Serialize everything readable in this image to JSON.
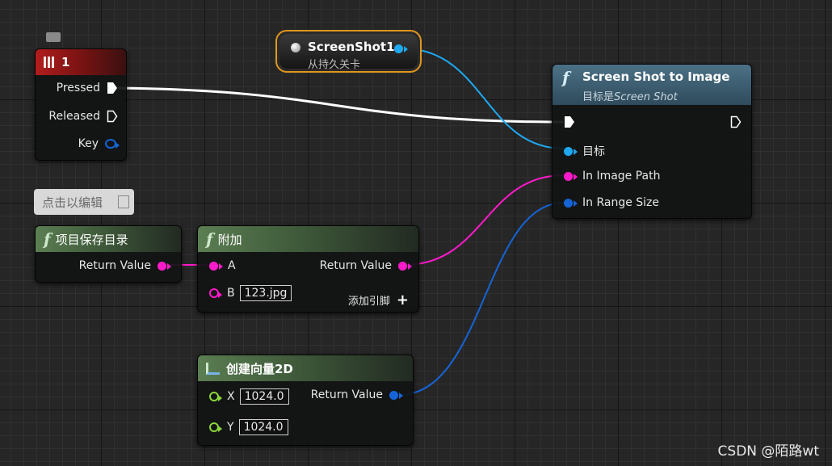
{
  "colors": {
    "exec_wire": "#ffffff",
    "string_wire": "#ff1acb",
    "object_wire": "#1ea8f0",
    "vector_wire": "#1565d8"
  },
  "event_node": {
    "title": "1",
    "pins": [
      "Pressed",
      "Released",
      "Key"
    ]
  },
  "comment_bubble": {
    "text": "点击以编辑"
  },
  "screenshot_node": {
    "title": "ScreenShot1",
    "subtitle": "从持久关卡"
  },
  "screen_shot_node": {
    "title": "Screen Shot to Image",
    "subtitle_prefix": "目标是",
    "subtitle_target": "Screen Shot",
    "pins": {
      "target": "目标",
      "image_path": "In Image Path",
      "range_size": "In Range Size"
    }
  },
  "project_dir_node": {
    "title": "项目保存目录",
    "output": "Return Value"
  },
  "append_node": {
    "title": "附加",
    "pin_a": "A",
    "pin_b": "B",
    "b_value": "123.jpg",
    "output": "Return Value",
    "add_pin": "添加引脚"
  },
  "make_vector_node": {
    "title": "创建向量2D",
    "pin_x": "X",
    "x_value": "1024.0",
    "pin_y": "Y",
    "y_value": "1024.0",
    "output": "Return Value"
  },
  "watermark": {
    "text": "CSDN @陌路wt"
  }
}
